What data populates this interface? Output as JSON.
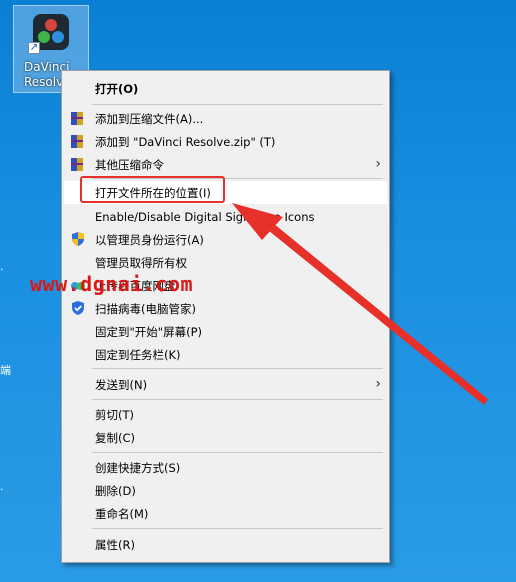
{
  "desktop": {
    "icon_label_line1": "DaVinci",
    "icon_label_line2": "Resolve",
    "edge_text": "端"
  },
  "watermark": "www.dgnai.com",
  "menu": {
    "items": [
      {
        "label": "打开(O)",
        "bold": true,
        "icon": "none"
      },
      {
        "label": "添加到压缩文件(A)...",
        "icon": "winrar-icon"
      },
      {
        "label": "添加到 \"DaVinci Resolve.zip\" (T)",
        "icon": "winrar-icon"
      },
      {
        "label": "其他压缩命令",
        "icon": "winrar-icon",
        "submenu": true
      },
      {
        "label": "打开文件所在的位置(I)",
        "icon": "none",
        "highlighted": true
      },
      {
        "label": "Enable/Disable Digital Signature Icons",
        "icon": "none"
      },
      {
        "label": "以管理员身份运行(A)",
        "icon": "uac-shield-icon"
      },
      {
        "label": "管理员取得所有权",
        "icon": "none"
      },
      {
        "label": "上传到百度网盘",
        "icon": "baidu-netdisk-icon"
      },
      {
        "label": "扫描病毒(电脑管家)",
        "icon": "tencent-shield-icon"
      },
      {
        "label": "固定到\"开始\"屏幕(P)",
        "icon": "none"
      },
      {
        "label": "固定到任务栏(K)",
        "icon": "none"
      },
      {
        "label": "发送到(N)",
        "icon": "none",
        "submenu": true
      },
      {
        "label": "剪切(T)",
        "icon": "none"
      },
      {
        "label": "复制(C)",
        "icon": "none"
      },
      {
        "label": "创建快捷方式(S)",
        "icon": "none"
      },
      {
        "label": "删除(D)",
        "icon": "none"
      },
      {
        "label": "重命名(M)",
        "icon": "none"
      },
      {
        "label": "属性(R)",
        "icon": "none"
      }
    ],
    "submenu_glyph": "›"
  },
  "colors": {
    "annotation_red": "#e8302a",
    "desktop_blue": "#1a8fe0",
    "menu_bg": "#f0f0f0"
  }
}
